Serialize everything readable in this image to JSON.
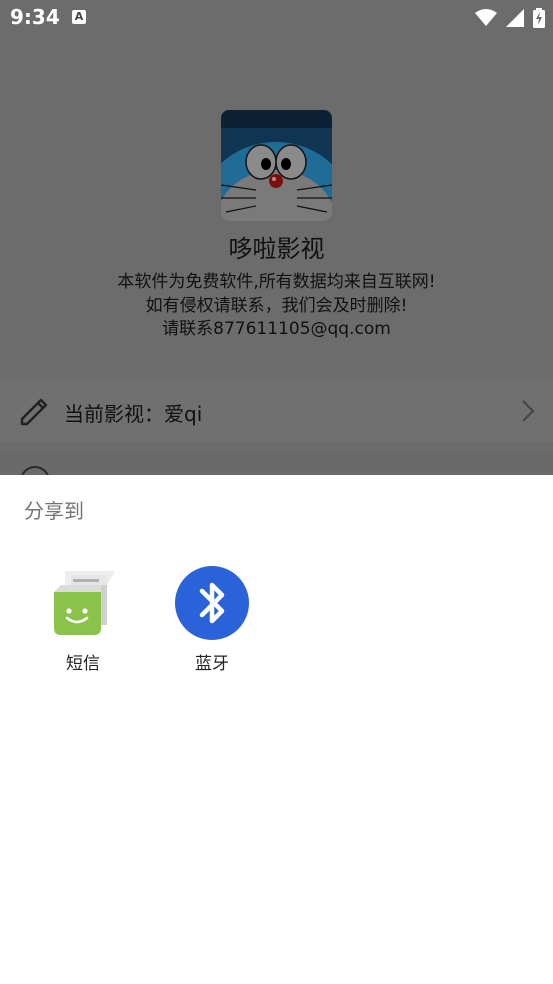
{
  "status_bar": {
    "time": "9:34",
    "notification_icon": "text-a-icon",
    "icons": [
      "wifi-icon",
      "cell-signal-icon",
      "battery-charging-icon"
    ]
  },
  "app": {
    "name": "哆啦影视",
    "notice_lines": [
      "本软件为免费软件,所有数据均来自互联网!",
      "如有侵权请联系，我们会及时删除!",
      "请联系877611105@qq.com"
    ],
    "current_source_label": "当前影视：爱qi"
  },
  "share_sheet": {
    "title": "分享到",
    "targets": [
      {
        "label": "短信",
        "icon": "sms-icon"
      },
      {
        "label": "蓝牙",
        "icon": "bluetooth-icon"
      }
    ]
  },
  "colors": {
    "scrim": "#6c6c6c",
    "sheet_bg": "#ffffff",
    "sms_green": "#8bc34a",
    "bluetooth_blue": "#2962d9"
  }
}
